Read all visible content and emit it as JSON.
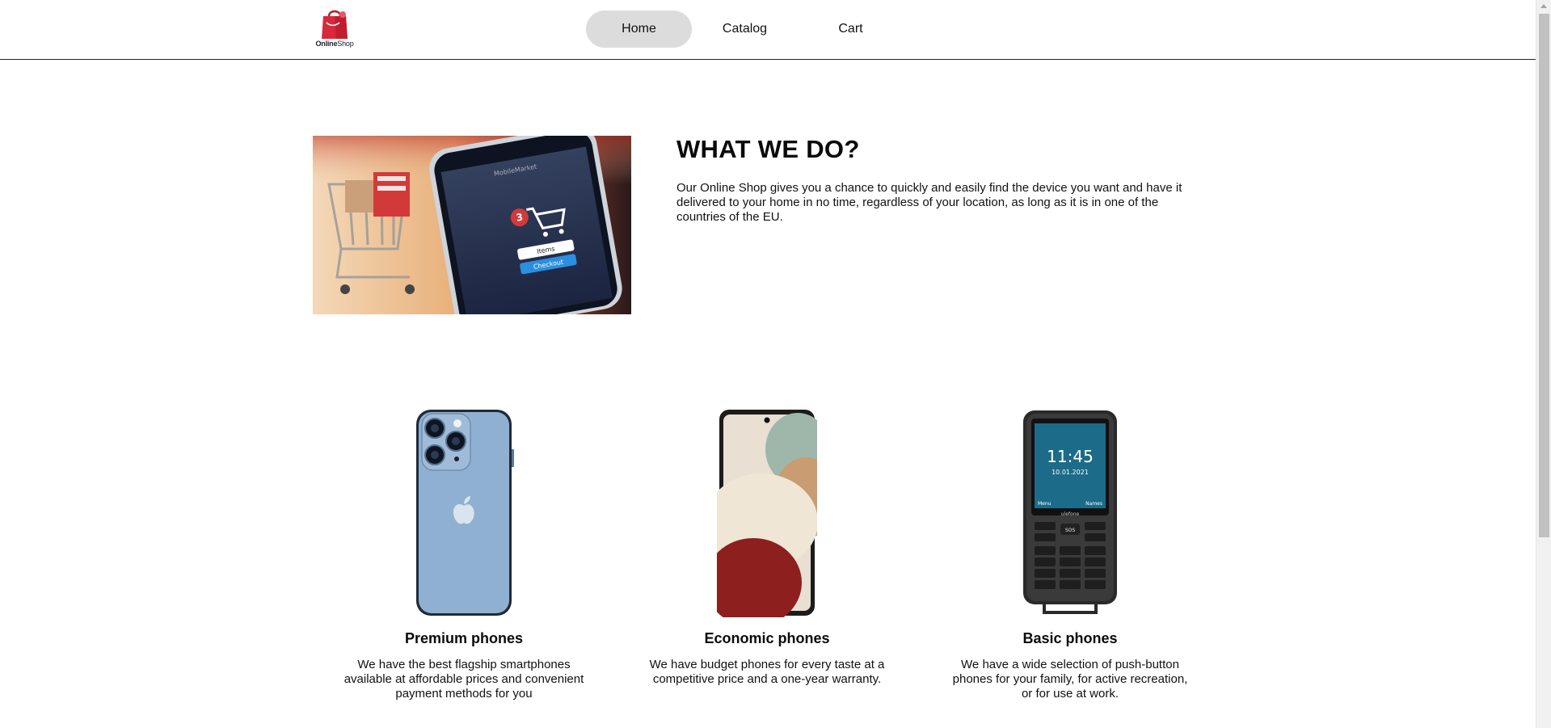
{
  "header": {
    "logo_brand_bold": "Online",
    "logo_brand_regular": "Shop",
    "nav": [
      {
        "label": "Home",
        "active": true
      },
      {
        "label": "Catalog",
        "active": false
      },
      {
        "label": "Cart",
        "active": false
      }
    ]
  },
  "about": {
    "title": "WHAT WE DO?",
    "text": "Our Online Shop gives you a chance to quickly and easily find the device you want and have it delivered to your home in no time, regardless of your location, as long as it is in one of the countries of the EU.",
    "image_screen_badge": "3",
    "image_screen_items": "Items",
    "image_screen_checkout": "Checkout",
    "image_screen_app": "MobileMarket"
  },
  "categories": [
    {
      "title": "Premium phones",
      "text": "We have the best flagship smartphones available at affordable prices and convenient payment methods for you"
    },
    {
      "title": "Economic phones",
      "text": "We have budget phones for every taste at a competitive price and a one-year warranty."
    },
    {
      "title": "Basic phones",
      "text": "We have a wide selection of push-button phones for your family, for active recreation, or for use at work."
    }
  ],
  "basic_phone_screen": {
    "time": "11:45",
    "date": "10.01.2021",
    "left_soft": "Menu",
    "right_soft": "Names",
    "brand": "ulefone",
    "sos": "SOS"
  },
  "colors": {
    "nav_active_bg": "#dcdcdc",
    "logo_red": "#d8283a",
    "header_border": "#222222"
  }
}
